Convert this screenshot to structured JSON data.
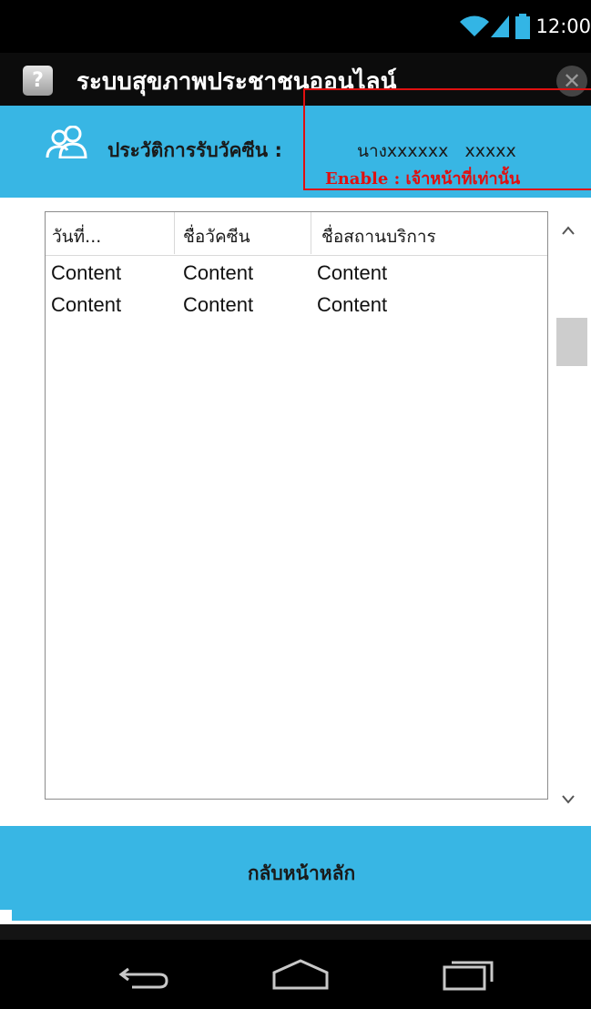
{
  "status_bar": {
    "time": "12:00",
    "icons": [
      "wifi-icon",
      "signal-icon",
      "battery-icon"
    ]
  },
  "title_bar": {
    "app_icon": "?",
    "title": "ระบบสุขภาพประชาชนออนไลน์",
    "close_icon": "close-icon"
  },
  "header": {
    "label": "ประวัติการรับวัคซีน :",
    "patient_name": "นางxxxxxx   xxxxx",
    "icon": "users-icon"
  },
  "annotation": {
    "text": "Enable : เจ้าหน้าที่เท่านั้น"
  },
  "table": {
    "columns": [
      "วันที่...",
      "ชื่อวัคซีน",
      "ชื่อสถานบริการ"
    ],
    "rows": [
      [
        "Content",
        "Content",
        "Content"
      ],
      [
        "Content",
        "Content",
        "Content"
      ]
    ]
  },
  "footer": {
    "home_button_label": "กลับหน้าหลัก"
  },
  "nav_bar": {
    "icons": [
      "back-icon",
      "home-icon",
      "recent-apps-icon"
    ]
  },
  "colors": {
    "accent": "#38b6e4",
    "annotation": "#e01010",
    "status_bar": "#000000"
  }
}
